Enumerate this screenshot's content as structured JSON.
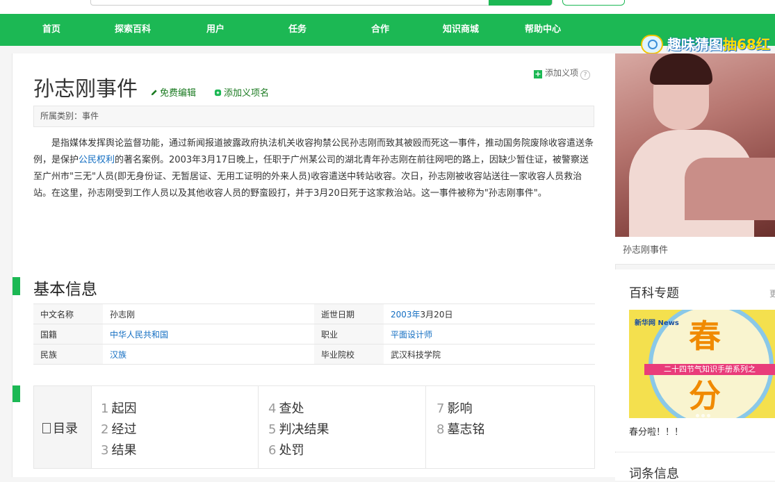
{
  "nav": {
    "items": [
      "首页",
      "探索百科",
      "用户",
      "任务",
      "合作",
      "知识商城",
      "帮助中心"
    ],
    "promo_pre": "趣味猜图",
    "promo_hl": "抽68红"
  },
  "article": {
    "title": "孙志刚事件",
    "edit_label": "免费编辑",
    "add_name_label": "添加义项名",
    "add_item_label": "添加义项",
    "category": "所属类别：事件",
    "summary_part1": "是指媒体发挥舆论监督功能，通过新闻报道披露政府执法机关收容拘禁公民孙志刚而致其被殴而死这一事件，推动国务院废除收容遣送条例，是保护",
    "summary_link": "公民权利",
    "summary_part2": "的著名案例。2003年3月17日晚上，任职于广州某公司的湖北青年孙志刚在前往网吧的路上，因缺少暂住证，被警察送至广州市\"三无\"人员(即无身份证、无暂居证、无用工证明的外来人员)收容遣送中转站收容。次日，孙志刚被收容站送往一家收容人员救治站。在这里，孙志刚受到工作人员以及其他收容人员的野蛮殴打，并于3月20日死于这家救治站。这一事件被称为\"孙志刚事件\"。"
  },
  "basic_info": {
    "title": "基本信息",
    "rows": [
      {
        "k1": "中文名称",
        "v1": "孙志刚",
        "k2": "逝世日期",
        "v2_link": "2003年",
        "v2": "3月20日"
      },
      {
        "k1": "国籍",
        "v1_link": "中华人民共和国",
        "k2": "职业",
        "v2_link": "平面设计师"
      },
      {
        "k1": "民族",
        "v1_link": "汉族",
        "k2": "毕业院校",
        "v2": "武汉科技学院"
      }
    ]
  },
  "toc": {
    "label": "目录",
    "items": [
      {
        "n": "1",
        "t": "起因"
      },
      {
        "n": "2",
        "t": "经过"
      },
      {
        "n": "3",
        "t": "结果"
      },
      {
        "n": "4",
        "t": "查处"
      },
      {
        "n": "5",
        "t": "判决结果"
      },
      {
        "n": "6",
        "t": "处罚"
      },
      {
        "n": "7",
        "t": "影响"
      },
      {
        "n": "8",
        "t": "墓志铭"
      }
    ]
  },
  "sidebar": {
    "photo_caption": "孙志刚事件",
    "topic_title": "百科专题",
    "topic_more": "更",
    "topic_img_big1": "春",
    "topic_img_big2": "分",
    "topic_img_band": "二十四节气知识手册系列之",
    "topic_img_logo": "新华网 News",
    "topic_caption": "春分啦！！！",
    "card2_title": "词条信息"
  },
  "colors": {
    "accent": "#1cb854",
    "link": "#136ec2"
  }
}
